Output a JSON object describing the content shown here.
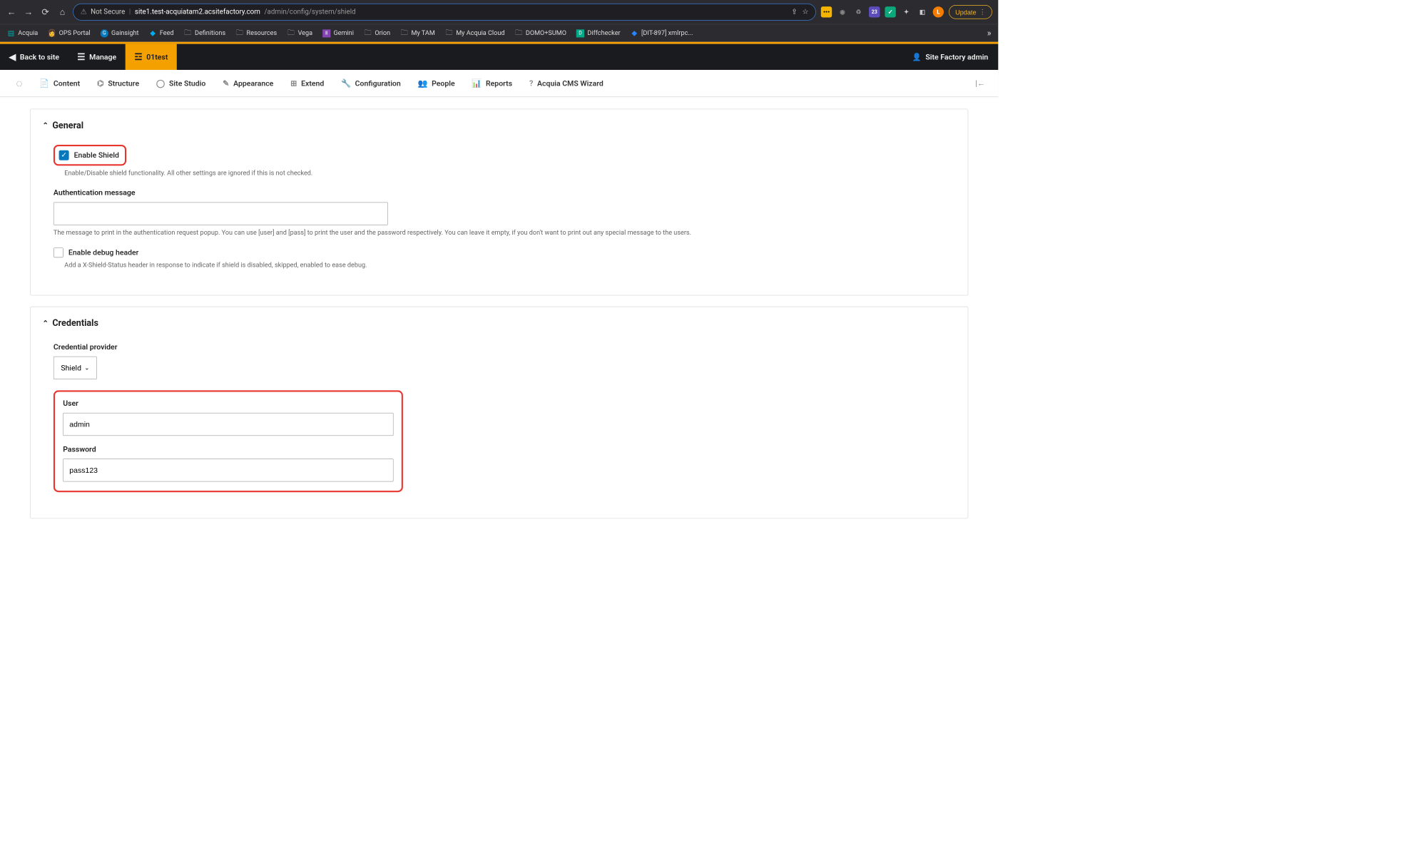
{
  "browser": {
    "not_secure": "Not Secure",
    "url_domain": "site1.test-acquiatam2.acsitefactory.com",
    "url_path": "/admin/config/system/shield",
    "update_label": "Update",
    "badge_23": "23"
  },
  "bookmarks": [
    {
      "label": "Acquia"
    },
    {
      "label": "OPS Portal"
    },
    {
      "label": "Gainsight"
    },
    {
      "label": "Feed"
    },
    {
      "label": "Definitions"
    },
    {
      "label": "Resources"
    },
    {
      "label": "Vega"
    },
    {
      "label": "Gemini"
    },
    {
      "label": "Orion"
    },
    {
      "label": "My TAM"
    },
    {
      "label": "My Acquia Cloud"
    },
    {
      "label": "DOMO+SUMO"
    },
    {
      "label": "Diffchecker"
    },
    {
      "label": "[DIT-897] xmlrpc..."
    }
  ],
  "toolbar": {
    "back": "Back to site",
    "manage": "Manage",
    "site": "01test",
    "user": "Site Factory admin"
  },
  "admin_menu": [
    "Content",
    "Structure",
    "Site Studio",
    "Appearance",
    "Extend",
    "Configuration",
    "People",
    "Reports",
    "Acquia CMS Wizard"
  ],
  "general": {
    "title": "General",
    "enable_shield": "Enable Shield",
    "enable_shield_desc": "Enable/Disable shield functionality. All other settings are ignored if this is not checked.",
    "auth_msg_label": "Authentication message",
    "auth_msg_value": "",
    "auth_msg_desc": "The message to print in the authentication request popup. You can use [user] and [pass] to print the user and the password respectively. You can leave it empty, if you don't want to print out any special message to the users.",
    "debug_label": "Enable debug header",
    "debug_desc": "Add a X-Shield-Status header in response to indicate if shield is disabled, skipped, enabled to ease debug."
  },
  "credentials": {
    "title": "Credentials",
    "provider_label": "Credential provider",
    "provider_value": "Shield",
    "user_label": "User",
    "user_value": "admin",
    "pass_label": "Password",
    "pass_value": "pass123"
  }
}
